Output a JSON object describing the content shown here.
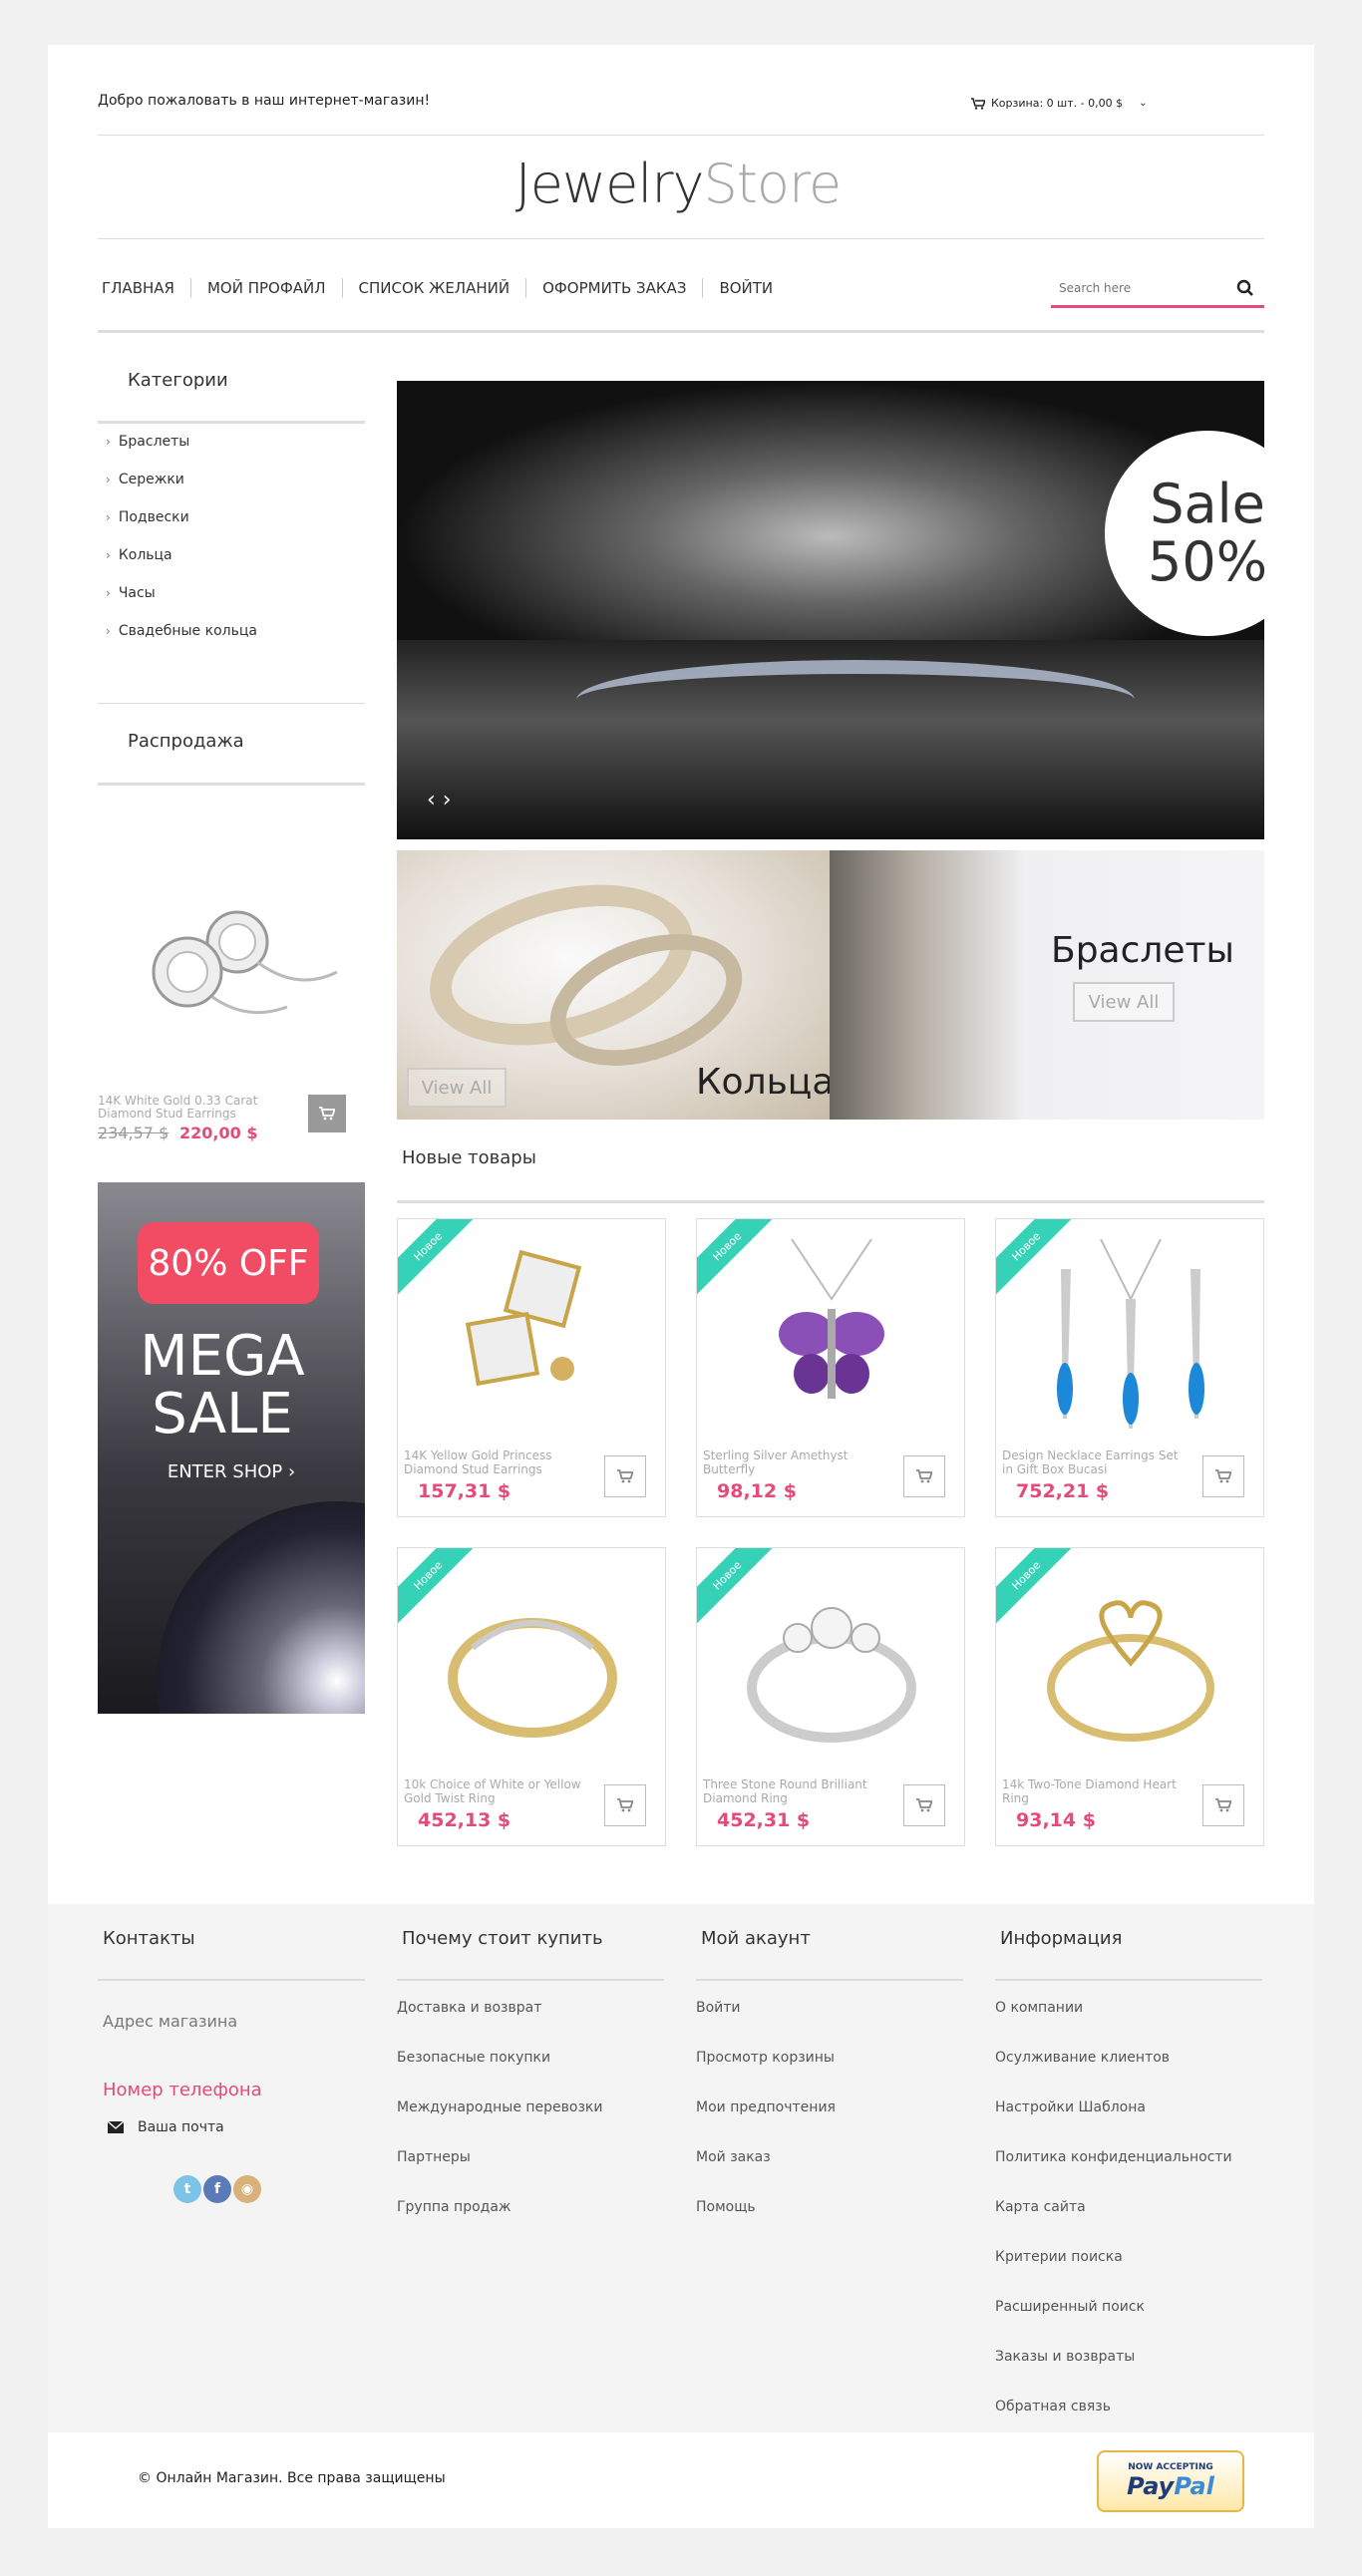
{
  "header": {
    "welcome": "Добро пожаловать в наш интернет-магазин!",
    "cart_label": "Корзина: 0 шт. - 0,00 $",
    "logo_a": "Jewelry",
    "logo_b": "Store"
  },
  "nav": {
    "items": [
      "ГЛАВНАЯ",
      "МОЙ ПРОФАЙЛ",
      "СПИСОК ЖЕЛАНИЙ",
      "ОФОРМИТЬ ЗАКАЗ",
      "ВОЙТИ"
    ],
    "search_placeholder": "Search here"
  },
  "sidebar": {
    "categories_title": "Категории",
    "categories": [
      "Браслеты",
      "Сережки",
      "Подвески",
      "Кольца",
      "Часы",
      "Свадебные кольца"
    ],
    "sale_title": "Распродажа",
    "sale_product": {
      "name": "14K White Gold 0.33 Carat Diamond Stud Earrings",
      "old_price": "234,57 $",
      "new_price": "220,00 $"
    },
    "mega": {
      "badge": "80% OFF",
      "line1": "MEGA",
      "line2": "SALE",
      "cta": "ENTER SHOP ›"
    }
  },
  "slider": {
    "sale_word": "Sale",
    "sale_pct": "50%",
    "arrows": "‹ ›"
  },
  "banners": {
    "rings_title": "Кольца",
    "rings_btn": "View All",
    "bracelets_title": "Браслеты",
    "bracelets_btn": "View All"
  },
  "new_products": {
    "title": "Новые товары",
    "ribbon": "Новое",
    "items": [
      {
        "name": "14K Yellow Gold Princess Diamond Stud Earrings",
        "price": "157,31 $"
      },
      {
        "name": "Sterling Silver Amethyst Butterfly",
        "price": "98,12 $"
      },
      {
        "name": "Design Necklace Earrings Set in Gift Box Bucasi",
        "price": "752,21 $"
      },
      {
        "name": "10k Choice of White or Yellow Gold Twist Ring",
        "price": "452,13 $"
      },
      {
        "name": "Three Stone Round Brilliant Diamond Ring",
        "price": "452,31 $"
      },
      {
        "name": "14k Two-Tone Diamond Heart Ring",
        "price": "93,14 $"
      }
    ]
  },
  "footer": {
    "contacts": {
      "title": "Контакты",
      "address": "Адрес магазина",
      "phone": "Номер телефона",
      "email": "Ваша почта"
    },
    "why": {
      "title": "Почему стоит купить",
      "links": [
        "Доставка и возврат",
        "Безопасные покупки",
        "Международные перевозки",
        "Партнеры",
        "Группа продаж"
      ]
    },
    "account": {
      "title": "Мой акаунт",
      "links": [
        "Войти",
        "Просмотр корзины",
        "Мои предпочтения",
        "Мой заказ",
        "Помощь"
      ]
    },
    "info": {
      "title": "Информация",
      "links": [
        "О компании",
        "Осулживание клиентов",
        "Настройки Шаблона",
        "Политика конфиденциальности",
        "Карта сайта",
        "Критерии поиска",
        "Расширенный поиск",
        "Заказы и возвраты",
        "Обратная связь"
      ]
    },
    "copyright": "© Онлайн Магазин. Все права защищены",
    "paypal_now": "NOW ACCEPTING",
    "paypal_a": "Pay",
    "paypal_b": "Pal"
  },
  "colors": {
    "accent": "#e24b7a",
    "ribbon": "#36d2b8",
    "mega_badge": "#f24c64"
  }
}
